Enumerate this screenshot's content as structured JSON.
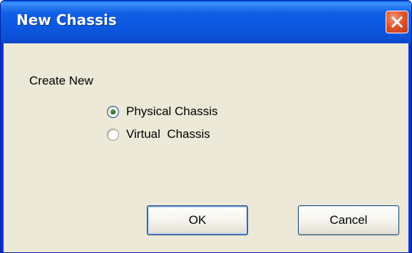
{
  "window": {
    "title": "New Chassis"
  },
  "dialog": {
    "group_label": "Create New",
    "options": [
      {
        "label": "Physical Chassis",
        "checked": true
      },
      {
        "label": "Virtual  Chassis",
        "checked": false
      }
    ],
    "ok_label": "OK",
    "cancel_label": "Cancel"
  },
  "icons": {
    "close": "close-icon"
  },
  "colors": {
    "titlebar": "#0a52d8",
    "client_bg": "#ece9d8",
    "close_button": "#e2542a",
    "radio_selected": "#1e6a1e"
  }
}
